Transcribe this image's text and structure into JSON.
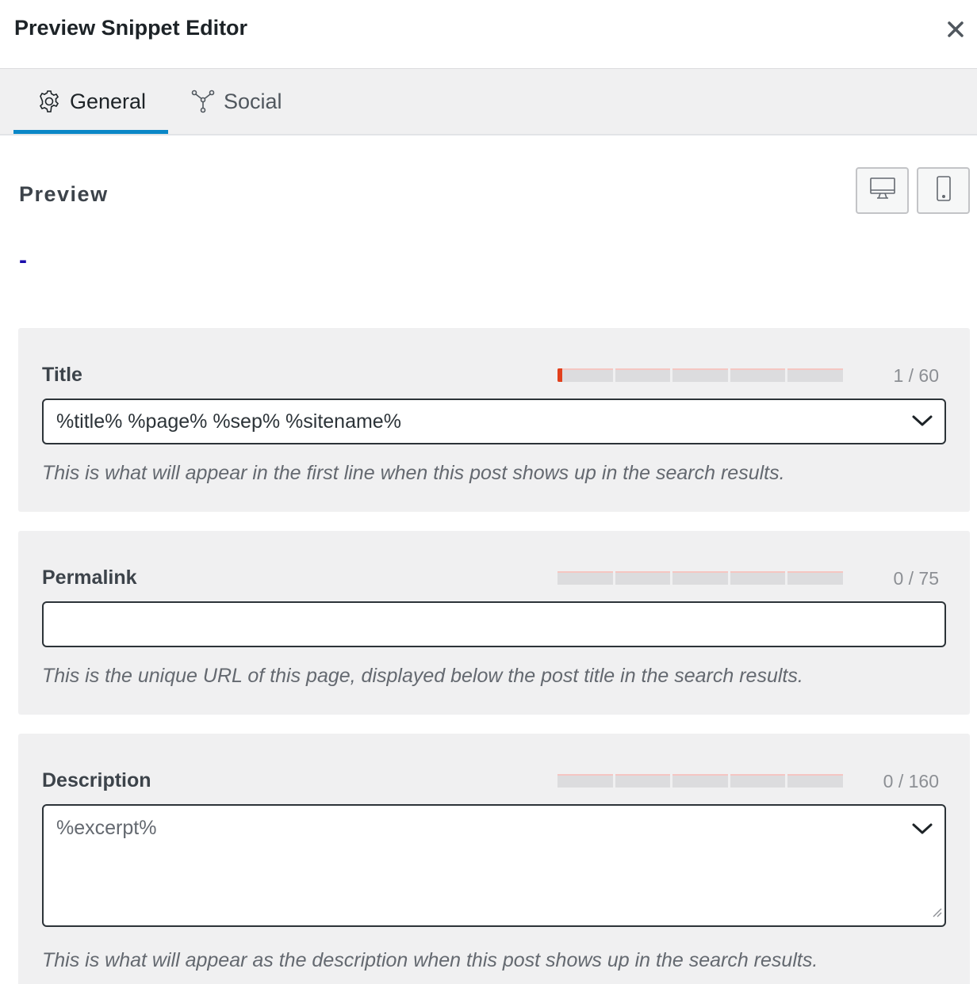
{
  "header": {
    "title": "Preview Snippet Editor",
    "close_icon": "close-icon"
  },
  "tabs": [
    {
      "label": "General",
      "icon": "gear-icon",
      "active": true
    },
    {
      "label": "Social",
      "icon": "share-network-icon",
      "active": false
    }
  ],
  "preview": {
    "heading": "Preview",
    "snippet_title": "-",
    "device_buttons": [
      "desktop-icon",
      "mobile-icon"
    ]
  },
  "fields": {
    "title": {
      "label": "Title",
      "counter": "1 / 60",
      "value": "%title% %page% %sep% %sitename%",
      "help": "This is what will appear in the first line when this post shows up in the search results.",
      "progress": 0.0167
    },
    "permalink": {
      "label": "Permalink",
      "counter": "0 / 75",
      "value": "",
      "help": "This is the unique URL of this page, displayed below the post title in the search results.",
      "progress": 0
    },
    "description": {
      "label": "Description",
      "counter": "0 / 160",
      "value": "%excerpt%",
      "help": "This is what will appear as the description when this post shows up in the search results.",
      "progress": 0
    }
  },
  "colors": {
    "accent": "#0a87c7",
    "meter_fill": "#e2401c",
    "preview_link": "#1a0dab"
  }
}
